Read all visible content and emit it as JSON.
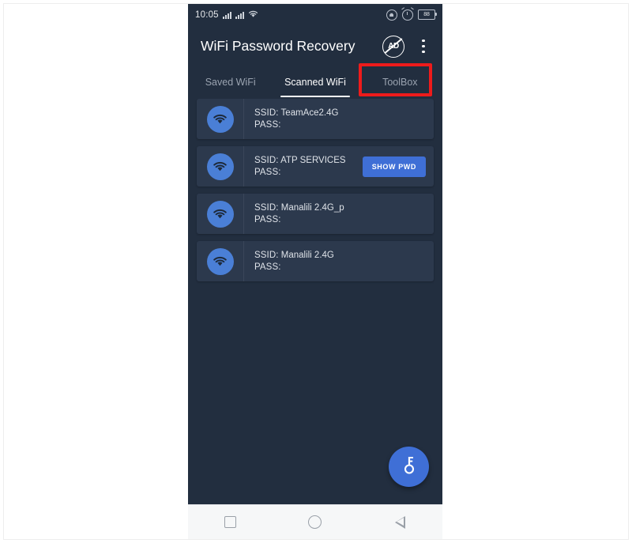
{
  "statusbar": {
    "time": "10:05",
    "signal_icon_1": "signal-bars-icon",
    "signal_icon_2": "signal-bars-icon",
    "wifi_icon": "wifi-icon",
    "rotation_lock_icon": "rotation-lock-icon",
    "alarm_icon": "alarm-clock-icon",
    "battery_level": "88"
  },
  "appbar": {
    "title": "WiFi Password Recovery",
    "no_ads_label": "AD",
    "no_ads_icon": "no-ads-icon",
    "overflow_icon": "overflow-menu-icon"
  },
  "tabs": [
    {
      "label": "Saved WiFi",
      "active": false
    },
    {
      "label": "Scanned WiFi",
      "active": true
    },
    {
      "label": "ToolBox",
      "active": false
    }
  ],
  "list": {
    "ssid_label": "SSID:",
    "pass_label": "PASS:",
    "items": [
      {
        "ssid": "TeamAce2.4G",
        "pass": "",
        "show_button": false
      },
      {
        "ssid": "ATP SERVICES",
        "pass": "",
        "show_button": true,
        "button_label": "SHOW PWD"
      },
      {
        "ssid": "Manalili 2.4G_p",
        "pass": "",
        "show_button": false
      },
      {
        "ssid": "Manalili 2.4G",
        "pass": "",
        "show_button": false
      }
    ]
  },
  "fab": {
    "icon": "key-icon"
  },
  "navbar": {
    "recents_icon": "recents-square-icon",
    "home_icon": "home-circle-icon",
    "back_icon": "back-triangle-icon"
  },
  "annotation": {
    "color": "#ee1b1b",
    "target": "SHOW PWD"
  },
  "colors": {
    "screen_background": "#222e3f",
    "card_background": "#2c394d",
    "accent_blue": "#3f6fd6",
    "badge_blue": "#4a7fd6",
    "text_primary": "#ffffff",
    "text_secondary": "#9aa3b0"
  }
}
